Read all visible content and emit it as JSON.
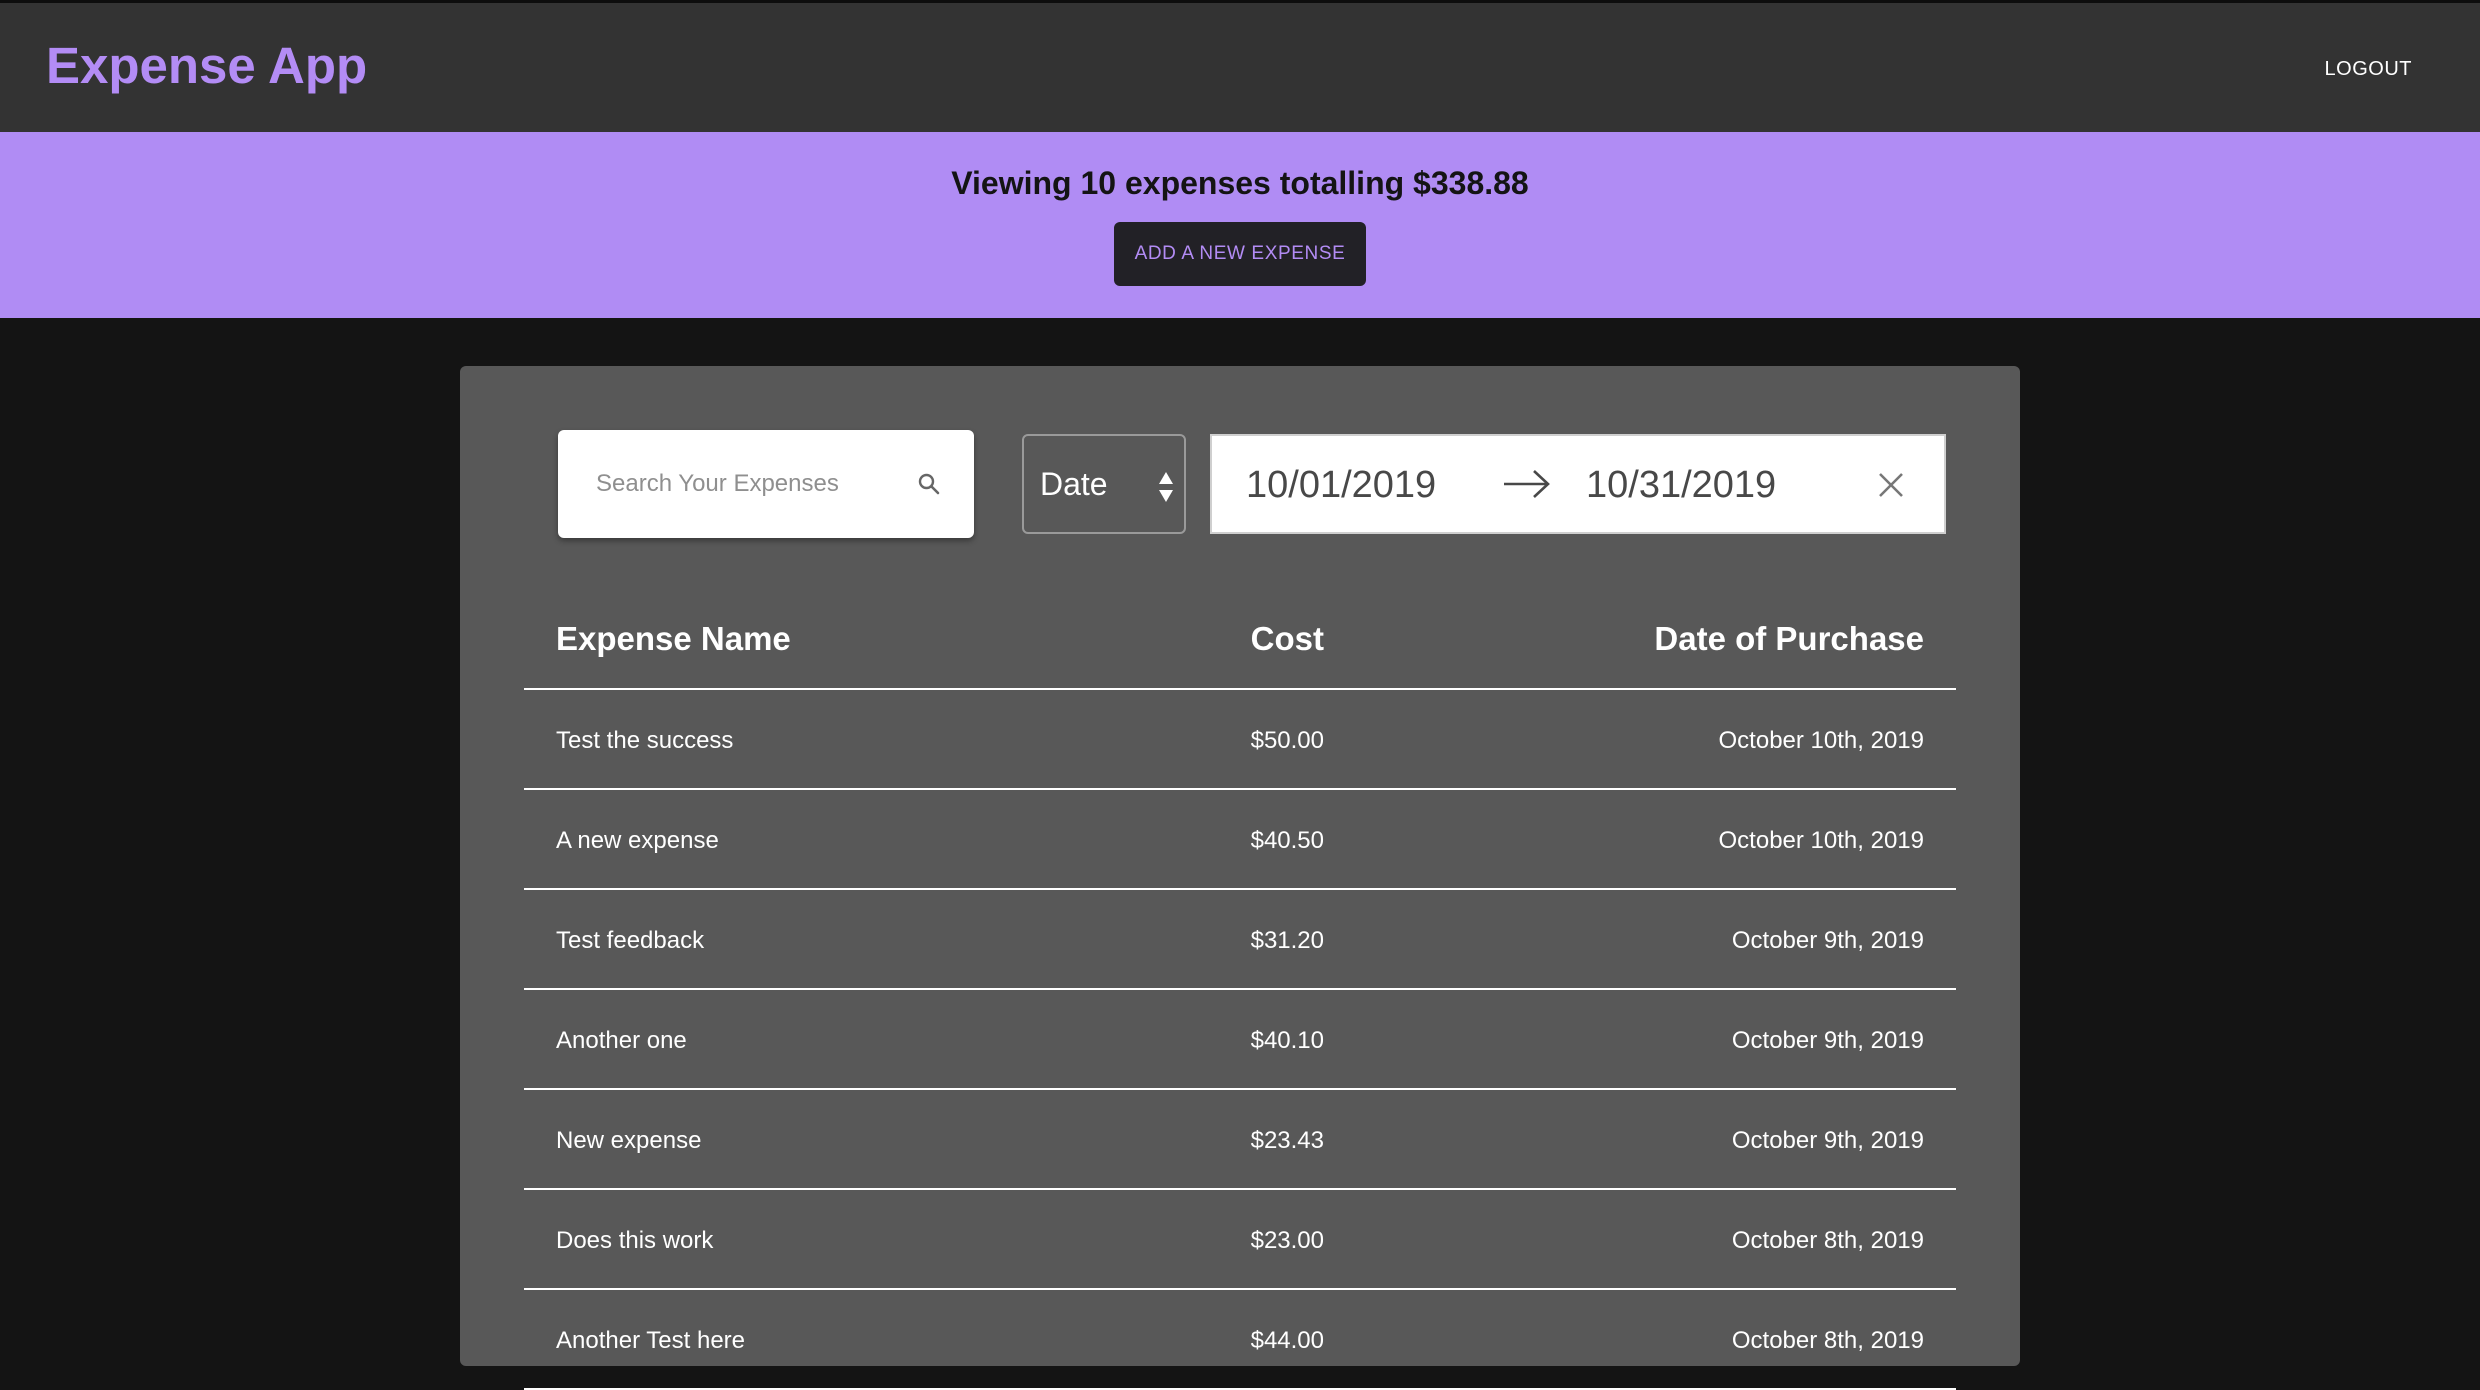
{
  "header": {
    "app_title": "Expense App",
    "logout_label": "LOGOUT"
  },
  "summary": {
    "text": "Viewing 10 expenses totalling $338.88",
    "add_button_label": "ADD A NEW EXPENSE"
  },
  "filters": {
    "search_placeholder": "Search Your Expenses",
    "search_value": "",
    "sort_by": "Date",
    "start_date": "10/01/2019",
    "end_date": "10/31/2019"
  },
  "table": {
    "columns": [
      "Expense Name",
      "Cost",
      "Date of Purchase"
    ],
    "rows": [
      {
        "name": "Test the success",
        "cost": "$50.00",
        "date": "October 10th, 2019"
      },
      {
        "name": "A new expense",
        "cost": "$40.50",
        "date": "October 10th, 2019"
      },
      {
        "name": "Test feedback",
        "cost": "$31.20",
        "date": "October 9th, 2019"
      },
      {
        "name": "Another one",
        "cost": "$40.10",
        "date": "October 9th, 2019"
      },
      {
        "name": "New expense",
        "cost": "$23.43",
        "date": "October 9th, 2019"
      },
      {
        "name": "Does this work",
        "cost": "$23.00",
        "date": "October 8th, 2019"
      },
      {
        "name": "Another Test here",
        "cost": "$44.00",
        "date": "October 8th, 2019"
      }
    ]
  },
  "colors": {
    "accent": "#b38cf5",
    "banner": "#b08cf4",
    "header_bg": "#333333",
    "panel_bg": "#585858",
    "page_bg": "#141414"
  },
  "icons": {
    "search": "search-icon",
    "sort": "sort-arrows-icon",
    "range": "arrow-right-icon",
    "clear": "close-icon"
  }
}
